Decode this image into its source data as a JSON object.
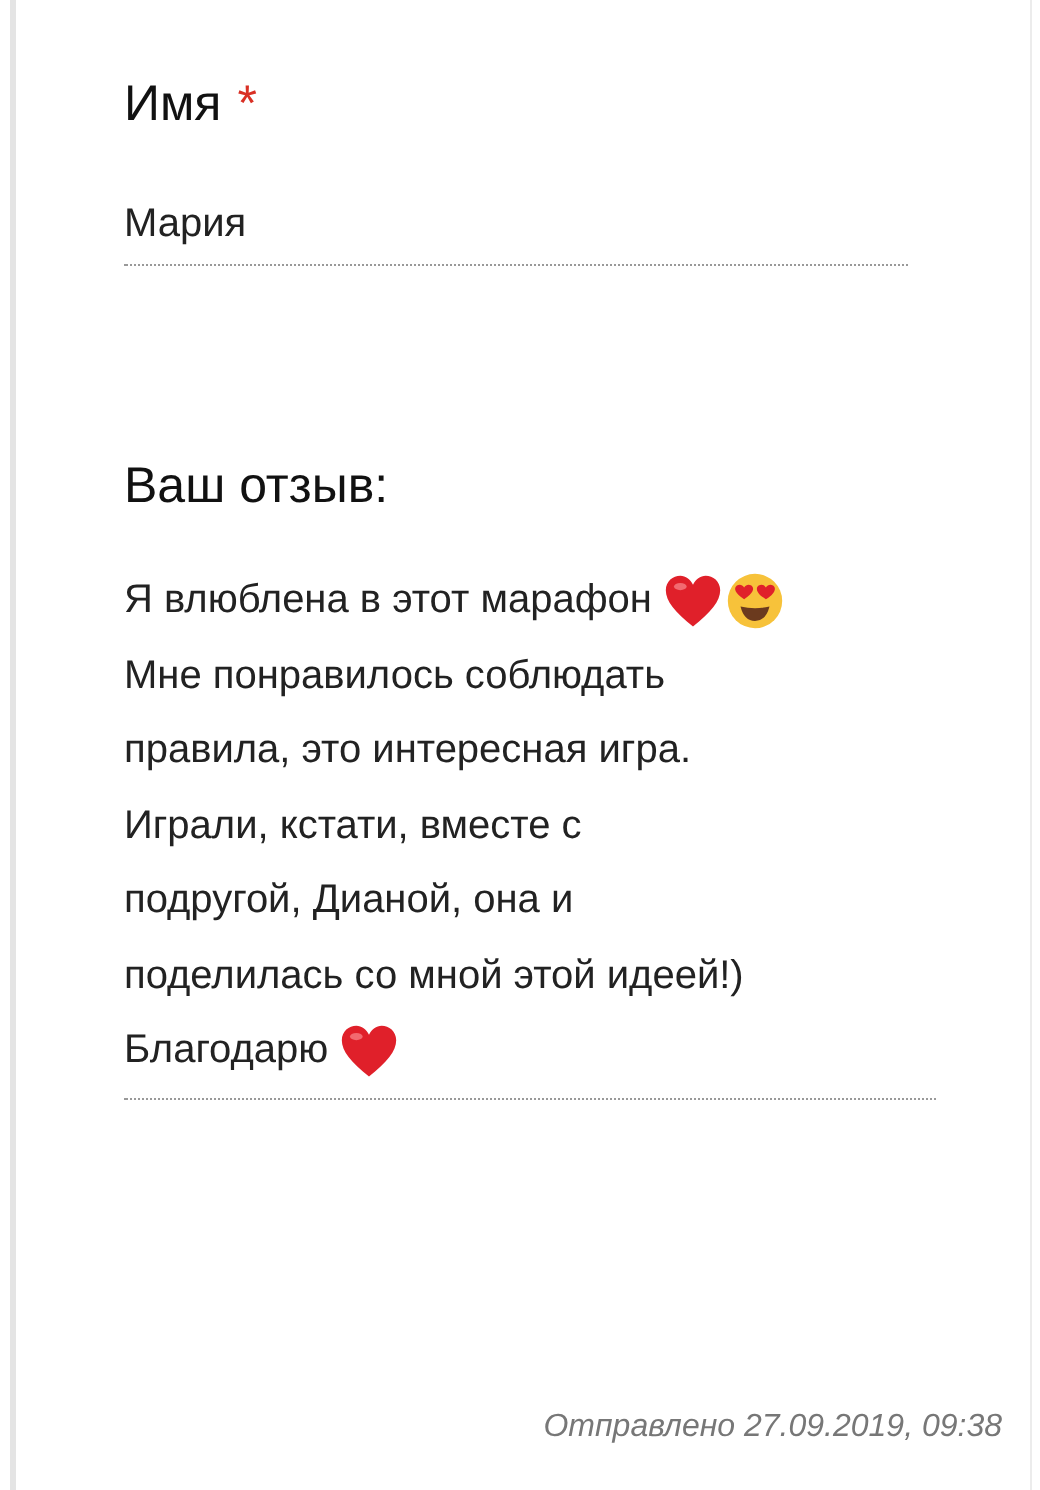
{
  "name_field": {
    "label": "Имя",
    "required": true,
    "required_mark": "*",
    "value": "Мария"
  },
  "review_field": {
    "label": "Ваш отзыв:",
    "lines": [
      {
        "text": "Я влюблена в этот марафон",
        "icons": [
          {
            "kind": "heart"
          },
          {
            "kind": "heart_eyes"
          }
        ]
      },
      {
        "text": "Мне понравилось соблюдать"
      },
      {
        "text": "правила, это интересная игра."
      },
      {
        "text": "Играли, кстати, вместе с"
      },
      {
        "text": "подругой, Дианой, она и"
      },
      {
        "text": "поделилась со мной этой идеей!)"
      },
      {
        "text": "Благодарю",
        "icons": [
          {
            "kind": "heart"
          }
        ]
      }
    ]
  },
  "footer": {
    "sent": "Отправлено 27.09.2019, 09:38"
  }
}
